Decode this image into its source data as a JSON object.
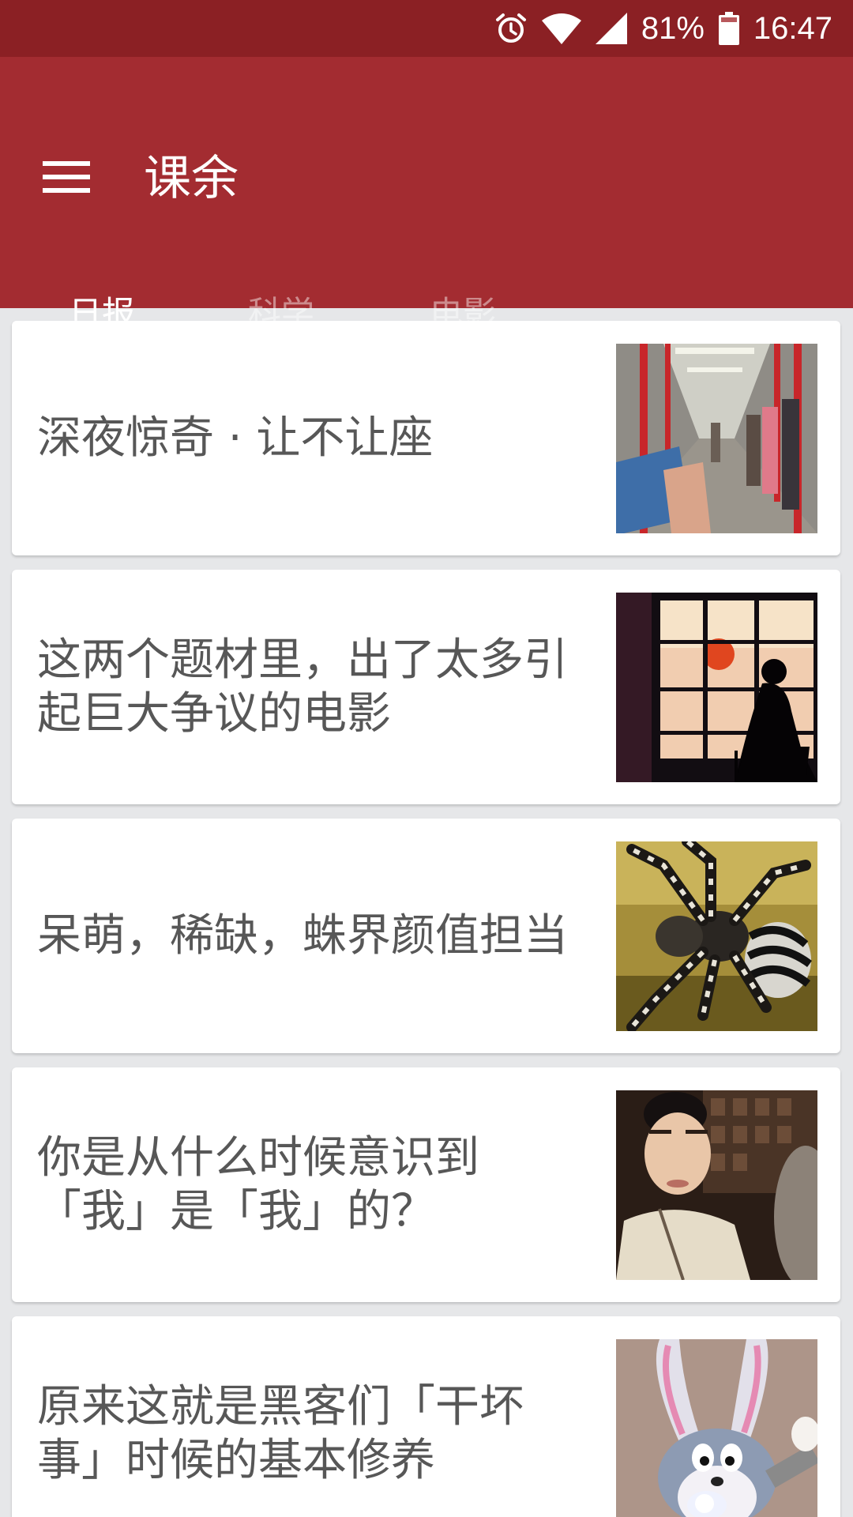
{
  "status_bar": {
    "battery": "81%",
    "time": "16:47",
    "icons": [
      "alarm-icon",
      "wifi-icon",
      "signal-icon",
      "battery-icon"
    ]
  },
  "app_bar": {
    "menu_icon": "menu-icon",
    "title": "课余"
  },
  "tabs": [
    {
      "label": "日报",
      "active": true
    },
    {
      "label": "科学",
      "active": false
    },
    {
      "label": "电影",
      "active": false
    }
  ],
  "articles": [
    {
      "title": "深夜惊奇 · 让不让座",
      "thumbnail": "subway-reading-image"
    },
    {
      "title": "这两个题材里，出了太多引起巨大争议的电影",
      "thumbnail": "window-silhouette-image"
    },
    {
      "title": "呆萌，稀缺，蛛界颜值担当",
      "thumbnail": "spider-image"
    },
    {
      "title": "你是从什么时候意识到「我」是「我」的？",
      "thumbnail": "tv-drama-still-image"
    },
    {
      "title": "原来这就是黑客们「干坏事」时候的基本修养",
      "thumbnail": "cartoon-rabbit-image"
    }
  ],
  "colors": {
    "status_bar": "#8b2024",
    "app_bar": "#a32c31",
    "background": "#e6e7e9",
    "card_text": "#575757"
  }
}
